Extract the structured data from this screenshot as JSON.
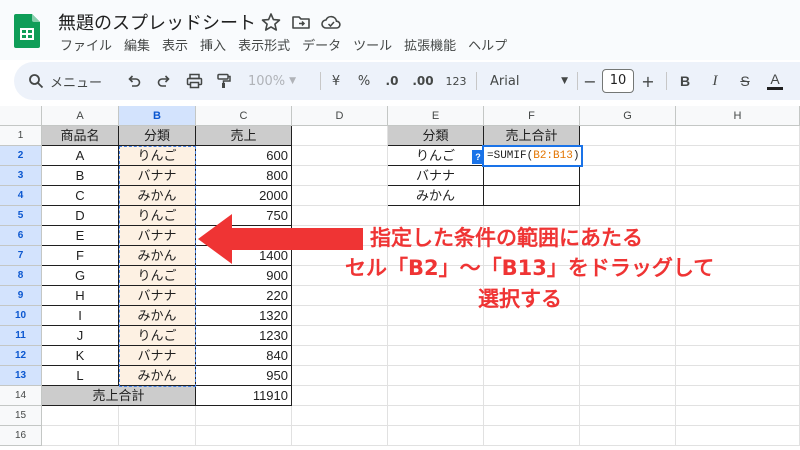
{
  "app": {
    "doc_title": "無題のスプレッドシート",
    "menu": [
      "ファイル",
      "編集",
      "表示",
      "挿入",
      "表示形式",
      "データ",
      "ツール",
      "拡張機能",
      "ヘルプ"
    ]
  },
  "toolbar": {
    "search_label": "メニュー",
    "zoom": "100%",
    "currency": "¥",
    "percent": "%",
    "decrease_decimal": ".0",
    "increase_decimal": ".00",
    "number_format": "123",
    "font": "Arial",
    "font_size": "10",
    "minus": "−",
    "plus": "+",
    "bold": "B",
    "italic": "I",
    "strike": "S",
    "text_color": "A"
  },
  "columns": [
    "A",
    "B",
    "C",
    "D",
    "E",
    "F",
    "G",
    "H"
  ],
  "rows": [
    "1",
    "2",
    "3",
    "4",
    "5",
    "6",
    "7",
    "8",
    "9",
    "10",
    "11",
    "12",
    "13",
    "14",
    "15",
    "16"
  ],
  "table_main": {
    "headers": [
      "商品名",
      "分類",
      "売上"
    ],
    "rows": [
      [
        "A",
        "りんご",
        "600"
      ],
      [
        "B",
        "バナナ",
        "800"
      ],
      [
        "C",
        "みかん",
        "2000"
      ],
      [
        "D",
        "りんご",
        "750"
      ],
      [
        "E",
        "バナナ",
        ""
      ],
      [
        "F",
        "みかん",
        "1400"
      ],
      [
        "G",
        "りんご",
        "900"
      ],
      [
        "H",
        "バナナ",
        "220"
      ],
      [
        "I",
        "みかん",
        "1320"
      ],
      [
        "J",
        "りんご",
        "1230"
      ],
      [
        "K",
        "バナナ",
        "840"
      ],
      [
        "L",
        "みかん",
        "950"
      ]
    ],
    "total_label": "売上合計",
    "total_value": "11910"
  },
  "table_summary": {
    "headers": [
      "分類",
      "売上合計"
    ],
    "rows": [
      "りんご",
      "バナナ",
      "みかん"
    ],
    "formula_prefix": "=SUMIF(",
    "formula_ref": "B2:B13",
    "formula_suffix": ")",
    "help_badge": "?"
  },
  "annotation": {
    "line1": "指定した条件の範囲にあたる",
    "line2": "セル「B2」～「B13」をドラッグして",
    "line3": "選択する"
  },
  "colors": {
    "accent": "#1a73e8",
    "annotation": "#ef3434",
    "range_fill": "#fdf1e3",
    "header_fill": "#cccccc"
  }
}
